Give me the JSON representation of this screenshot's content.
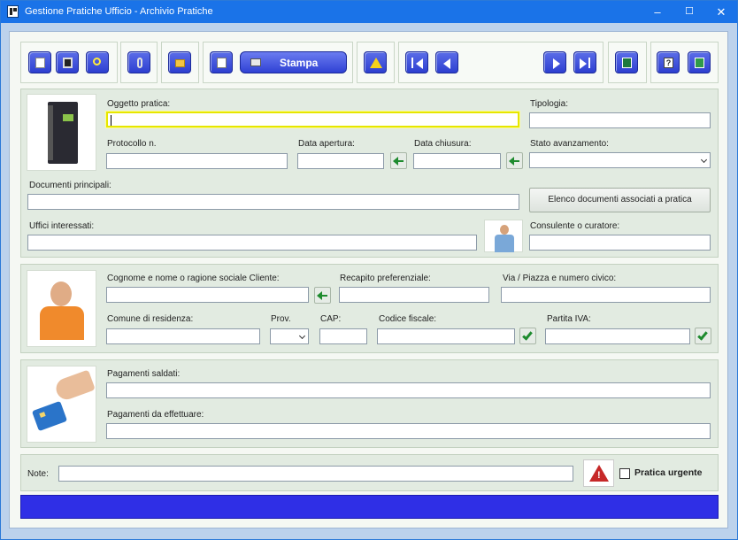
{
  "window": {
    "title": "Gestione Pratiche Ufficio - Archivio Pratiche",
    "minimize_glyph": "–",
    "maximize_glyph": "☐",
    "close_glyph": "✕"
  },
  "toolbar": {
    "print_label": "Stampa",
    "help_glyph": "?"
  },
  "pratica": {
    "oggetto_label": "Oggetto pratica:",
    "oggetto_value": "",
    "tipologia_label": "Tipologia:",
    "tipologia_value": "",
    "protocollo_label": "Protocollo n.",
    "protocollo_value": "",
    "data_apertura_label": "Data apertura:",
    "data_apertura_value": "",
    "data_chiusura_label": "Data chiusura:",
    "data_chiusura_value": "",
    "stato_label": "Stato avanzamento:",
    "stato_value": "",
    "documenti_label": "Documenti principali:",
    "documenti_value": "",
    "elenco_button": "Elenco documenti associati a pratica",
    "uffici_label": "Uffici interessati:",
    "uffici_value": "",
    "consulente_label": "Consulente o curatore:",
    "consulente_value": ""
  },
  "cliente": {
    "nome_label": "Cognome e nome o ragione sociale Cliente:",
    "nome_value": "",
    "recapito_label": "Recapito preferenziale:",
    "recapito_value": "",
    "via_label": "Via / Piazza e numero civico:",
    "via_value": "",
    "comune_label": "Comune di residenza:",
    "comune_value": "",
    "prov_label": "Prov.",
    "prov_value": "",
    "cap_label": "CAP:",
    "cap_value": "",
    "cf_label": "Codice fiscale:",
    "cf_value": "",
    "piva_label": "Partita IVA:",
    "piva_value": ""
  },
  "pagamenti": {
    "saldati_label": "Pagamenti saldati:",
    "saldati_value": "",
    "da_effettuare_label": "Pagamenti da effettuare:",
    "da_effettuare_value": ""
  },
  "note": {
    "label": "Note:",
    "value": "",
    "urgente_label": "Pratica urgente",
    "urgente_checked": false
  },
  "colors": {
    "titlebar": "#1a73e8",
    "toolbar_button": "#2d3fd0",
    "status_bar": "#2f2fe6",
    "focus_border": "#e6e600",
    "panel": "#e2ebe1"
  }
}
